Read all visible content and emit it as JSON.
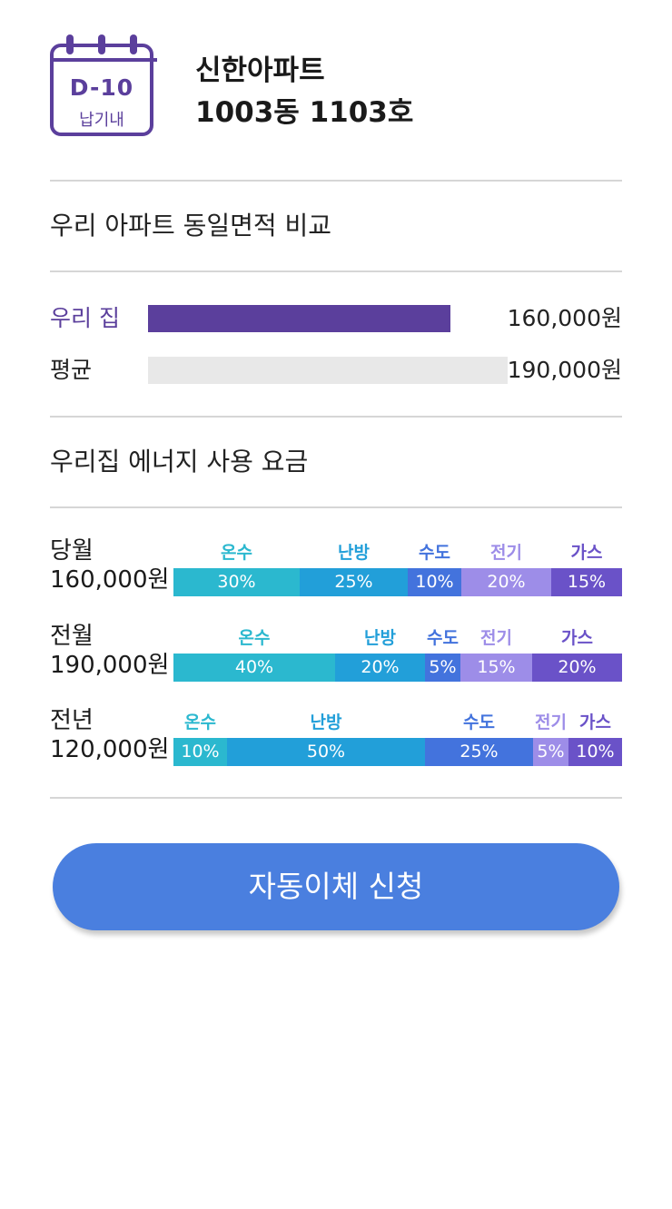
{
  "header": {
    "dday": "D-10",
    "due_label": "납기내",
    "apt_name": "신한아파트",
    "unit": "1003동 1103호"
  },
  "comparison": {
    "title": "우리 아파트 동일면적 비교",
    "rows": [
      {
        "label": "우리 집",
        "value": "160,000원",
        "amount": 160000,
        "color": "#5b3f9c",
        "label_color": "#5b3f9c"
      },
      {
        "label": "평균",
        "value": "190,000원",
        "amount": 190000,
        "color": "#e8e8e8",
        "label_color": "#222222"
      }
    ]
  },
  "energy": {
    "title": "우리집 에너지 사용 요금",
    "categories": [
      {
        "name": "온수",
        "color": "#2bb8cf",
        "label_color": "#2bb8cf"
      },
      {
        "name": "난방",
        "color": "#229fd9",
        "label_color": "#229fd9"
      },
      {
        "name": "수도",
        "color": "#4373dd",
        "label_color": "#4373dd"
      },
      {
        "name": "전기",
        "color": "#9d8de8",
        "label_color": "#9d8de8"
      },
      {
        "name": "가스",
        "color": "#6a52c8",
        "label_color": "#6a52c8"
      }
    ],
    "rows": [
      {
        "name": "당월",
        "total": "160,000원",
        "shares": [
          30,
          25,
          10,
          20,
          15
        ]
      },
      {
        "name": "전월",
        "total": "190,000원",
        "shares": [
          40,
          20,
          5,
          15,
          20
        ]
      },
      {
        "name": "전년",
        "total": "120,000원",
        "shares": [
          10,
          50,
          25,
          5,
          10
        ]
      }
    ]
  },
  "action": {
    "button_label": "자동이체 신청"
  }
}
